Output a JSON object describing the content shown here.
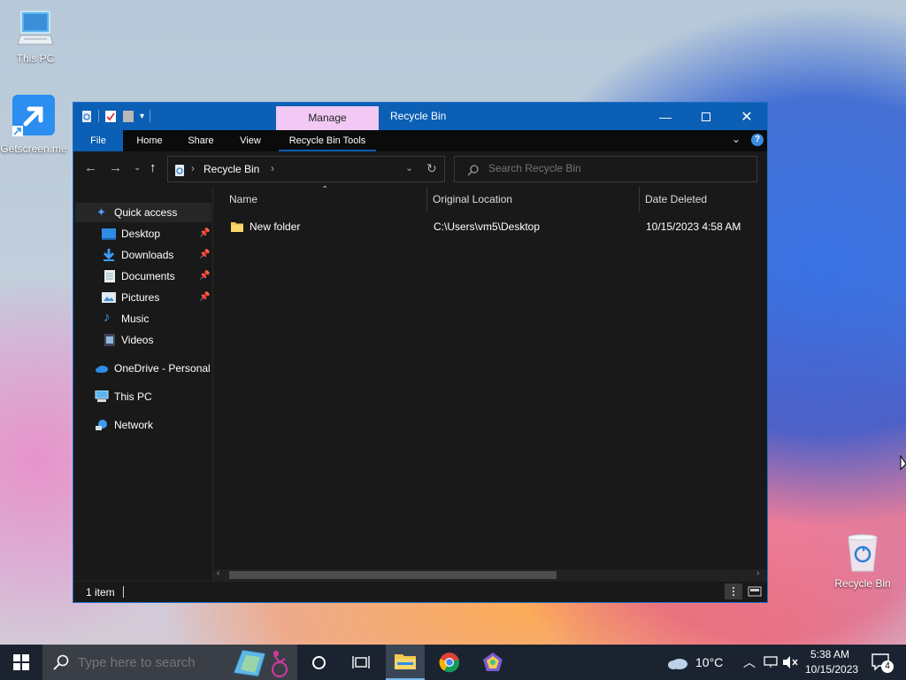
{
  "desktop": {
    "icons": [
      {
        "label": "This PC"
      },
      {
        "label": "Getscreen.me"
      },
      {
        "label": "Recycle Bin"
      }
    ]
  },
  "window": {
    "title": "Recycle Bin",
    "manage_tab": "Manage",
    "ribbon_tabs": [
      "File",
      "Home",
      "Share",
      "View",
      "Recycle Bin Tools"
    ],
    "help": "?",
    "address_path": "Recycle Bin",
    "search_placeholder": "Search Recycle Bin",
    "sidebar": {
      "quick_access": "Quick access",
      "pinned": [
        "Desktop",
        "Downloads",
        "Documents",
        "Pictures"
      ],
      "unpinned": [
        "Music",
        "Videos"
      ],
      "onedrive": "OneDrive - Personal",
      "this_pc": "This PC",
      "network": "Network"
    },
    "columns": [
      "Name",
      "Original Location",
      "Date Deleted"
    ],
    "rows": [
      {
        "name": "New folder",
        "original_location": "C:\\Users\\vm5\\Desktop",
        "date_deleted": "10/15/2023 4:58 AM"
      }
    ],
    "status": "1 item"
  },
  "taskbar": {
    "search_placeholder": "Type here to search",
    "weather": "10°C",
    "time": "5:38 AM",
    "date": "10/15/2023",
    "notifications": "4"
  },
  "colors": {
    "accent": "#0b5fb4",
    "manage_tab": "#f1c9f4",
    "window_bg": "#191919",
    "taskbar_bg": "#1b2330"
  }
}
